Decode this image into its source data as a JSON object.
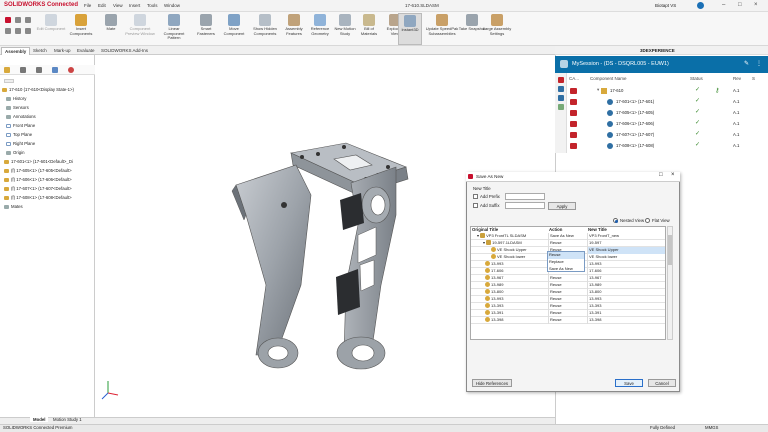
{
  "app": {
    "brand": "SOLIDWORKS Connected",
    "menus": [
      "File",
      "Edit",
      "View",
      "Insert",
      "Tools",
      "Window"
    ],
    "doc_title": "17-610.SLDASM",
    "user": "Biotapt VS"
  },
  "ribbon": [
    "Edit Component",
    "Insert Components",
    "Mate",
    "Component Preview Window",
    "Linear Component Pattern",
    "Smart Fasteners",
    "Move Component",
    "Show Hidden Components",
    "Assembly Features",
    "Reference Geometry",
    "New Motion Study",
    "Bill of Materials",
    "Exploded View",
    "Instant3D",
    "Update SpeedPak Subassemblies",
    "Take Snapshot",
    "Large Assembly Settings"
  ],
  "tabs": [
    "Assembly",
    "Sketch",
    "Mark-up",
    "Evaluate",
    "SOLIDWORKS Add-Ins"
  ],
  "feature_tree": [
    "17-610 (17-610<Display State-1>)",
    "History",
    "Sensors",
    "Annotations",
    "Front Plane",
    "Top Plane",
    "Right Plane",
    "Origin",
    "17-601<1> (17-601<Default>_Di",
    "(f) 17-605<1> (17-605<Default>",
    "(f) 17-606<1> (17-606<Default>",
    "(f) 17-607<1> (17-607<Default>",
    "(f) 17-608<1> (17-608<Default>",
    "Mates"
  ],
  "bottom_tabs": [
    "Model",
    "Motion Study 1"
  ],
  "status": {
    "left": "SOLIDWORKS Connected Premium",
    "mid": "Fully Defined",
    "units": "MMGS"
  },
  "dx": {
    "title": "3DEXPERIENCE",
    "session": "MySession - (DS - DSQRL005 - EUW1)",
    "columns": {
      "ca": "CA...",
      "name": "Component Name",
      "status": "Status",
      "rev": "Rev",
      "s": "S"
    },
    "rows": [
      {
        "name": "17-610",
        "rev": "A.1"
      },
      {
        "name": "17-601<1> (17-601)",
        "rev": "A.1"
      },
      {
        "name": "17-605<1> (17-605)",
        "rev": "A.1"
      },
      {
        "name": "17-606<1> (17-606)",
        "rev": "A.1"
      },
      {
        "name": "17-607<1> (17-607)",
        "rev": "A.1"
      },
      {
        "name": "17-608<1> (17-608)",
        "rev": "A.1"
      }
    ]
  },
  "dialog": {
    "title": "Save As New",
    "new_title_label": "New Title",
    "add_prefix": "Add Prefix",
    "add_suffix": "Add Suffix",
    "apply": "Apply",
    "nested_view": "Nested View",
    "flat_view": "Flat View",
    "columns": {
      "orig": "Original Title",
      "action": "Action",
      "new": "New Title"
    },
    "rows": [
      {
        "orig": "VP3 FrontTL SLDASM",
        "action": "Save As New",
        "new": "VP3 FrontT_new"
      },
      {
        "orig": "19-597.1LDASM",
        "action": "Reuse",
        "new": "19-597"
      },
      {
        "orig": "VE Shock Upper",
        "action": "Reuse",
        "new": "VE Shock Upper"
      },
      {
        "orig": "VE Shock lower",
        "action": "Reuse",
        "new": "VE Shock lower"
      },
      {
        "orig": "13-993",
        "action": "Reuse",
        "new": "13-993"
      },
      {
        "orig": "17-606",
        "action": "Reuse",
        "new": "17-606"
      },
      {
        "orig": "13-967",
        "action": "Reuse",
        "new": "13-967"
      },
      {
        "orig": "13-989",
        "action": "Reuse",
        "new": "13-989"
      },
      {
        "orig": "13-800",
        "action": "Reuse",
        "new": "13-800"
      },
      {
        "orig": "13-993",
        "action": "Reuse",
        "new": "13-993"
      },
      {
        "orig": "13-393",
        "action": "Reuse",
        "new": "13-393"
      },
      {
        "orig": "13-391",
        "action": "Reuse",
        "new": "13-391"
      },
      {
        "orig": "13-398",
        "action": "Reuse",
        "new": "13-398"
      }
    ],
    "dropdown_options": [
      "Reuse",
      "Replace",
      "Save As New"
    ],
    "hide_references": "Hide References",
    "save": "Save",
    "cancel": "Cancel"
  }
}
